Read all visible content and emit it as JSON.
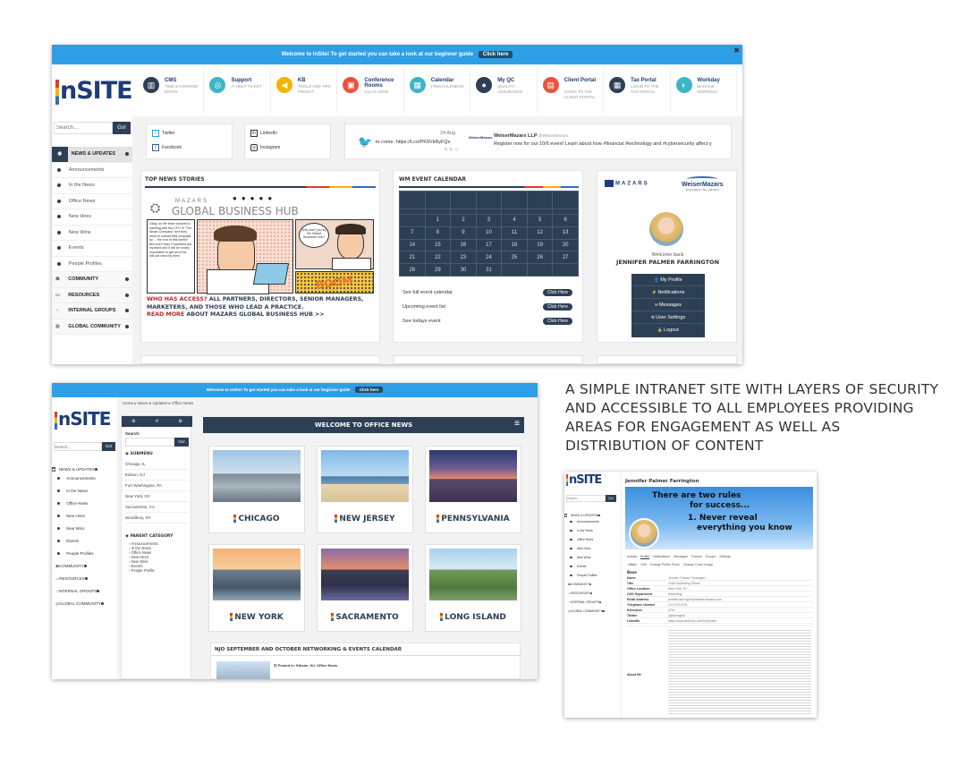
{
  "caption": "A SIMPLE INTRANET SITE WITH LAYERS OF SECURITY AND ACCESSIBLE TO ALL EMPLOYEES PROVIDING AREAS FOR ENGAGEMENT AS WELL AS DISTRIBUTION OF CONTENT",
  "topbar": {
    "text": "Welcome to InSite! To get started you can take a look at our beginner guide",
    "button": "Click here"
  },
  "logo": "nSITE",
  "search": {
    "placeholder": "Search...",
    "button": "Go!"
  },
  "sidebar": [
    {
      "label": "NEWS & UPDATES",
      "type": "main",
      "icon": "rss-icon"
    },
    {
      "label": "Announcements",
      "type": "sub"
    },
    {
      "label": "In the News",
      "type": "sub"
    },
    {
      "label": "Office News",
      "type": "sub"
    },
    {
      "label": "New Hires",
      "type": "sub"
    },
    {
      "label": "New Wins",
      "type": "sub"
    },
    {
      "label": "Events",
      "type": "sub"
    },
    {
      "label": "People Profiles",
      "type": "sub"
    },
    {
      "label": "COMMUNITY",
      "type": "main",
      "icon": "people-icon"
    },
    {
      "label": "RESOURCES",
      "type": "main",
      "icon": "folder-icon"
    },
    {
      "label": "INTERNAL GROUPS",
      "type": "main",
      "icon": "lightbulb-icon"
    },
    {
      "label": "GLOBAL COMMUNITY",
      "type": "main",
      "icon": "globe-icon"
    }
  ],
  "quicklinks": [
    {
      "title": "CMS",
      "sub": "TIME & EXPENSE ENTRY",
      "color": "#2d3f55",
      "icon": "chart-icon"
    },
    {
      "title": "Support",
      "sub": "IT HELP TICKET",
      "color": "#3fb5c8",
      "icon": "lifebuoy-icon"
    },
    {
      "title": "KB",
      "sub": "TOOLS AND TIPS FROM IT",
      "color": "#f5b400",
      "icon": "share-icon"
    },
    {
      "title": "Conference Rooms",
      "sub": "CLICK HERE",
      "color": "#e8543f",
      "icon": "monitor-icon"
    },
    {
      "title": "Calendar",
      "sub": "FIRM CALENDAR",
      "color": "#3fb5c8",
      "icon": "calendar-icon"
    },
    {
      "title": "My QC",
      "sub": "QUALITY ASSURANCE",
      "color": "#2d3f55",
      "icon": "users-icon"
    },
    {
      "title": "Client Portal",
      "sub": "LOGIN TO THE CLIENT PORTAL",
      "color": "#e8543f",
      "icon": "briefcase-icon"
    },
    {
      "title": "Tax Portal",
      "sub": "LOGIN TO THE TAX PORTAL",
      "color": "#2d3f55",
      "icon": "calculator-icon"
    },
    {
      "title": "Workday",
      "sub": "MANAGE WORKDAY",
      "color": "#3fb5c8",
      "icon": "workday-icon"
    }
  ],
  "social": {
    "twitter": "Twitter",
    "facebook": "Facebook",
    "linkedin": "LinkedIn",
    "instagram": "Instagram"
  },
  "tweets": {
    "t1_date": "24 Aug",
    "t1_text": "to come. https://t.co/PK9VkRyFQs",
    "t1_meta": "↰ ↻ ☆",
    "t2_name": "WeiserMazars LLP",
    "t2_handle": "@WeiserMazars",
    "t2_text": "Register now for our 10/6 event! Learn about how #financial #technology and #cybersecurity affect y",
    "t2_logo": "WeiserMazars"
  },
  "news": {
    "heading": "TOP NEWS STORIES",
    "banner_top": "MAZARS",
    "banner": "GLOBAL BUSINESS HUB",
    "speech1": "Okay, as the team secured a meeting with the CFO of \"The Smart Company\" and they need to submit their proposal by ... the end of this week!! But more than 3 countries are involved and it will be nearly impossible to get all of the info we need by then!",
    "speech2": "Why don't you try the Global Business Hub?",
    "boom": "BOOM",
    "who_q": "WHO HAS ACCESS?",
    "who_a": "ALL PARTNERS, DIRECTORS, SENIOR MANAGERS, MARKETERS, AND THOSE WHO LEAD A PRACTICE.",
    "read_more": "READ MORE",
    "read_more_rest": "ABOUT MAZARS GLOBAL BUSINESS HUB >>"
  },
  "calendar": {
    "heading": "WM EVENT CALENDAR",
    "rows": [
      [
        "",
        "1",
        "2",
        "3",
        "4",
        "5",
        "6"
      ],
      [
        "7",
        "8",
        "9",
        "10",
        "11",
        "12",
        "13"
      ],
      [
        "14",
        "15",
        "16",
        "17",
        "18",
        "19",
        "20"
      ],
      [
        "21",
        "22",
        "23",
        "24",
        "25",
        "26",
        "27"
      ],
      [
        "28",
        "29",
        "30",
        "31",
        "",
        "",
        ""
      ]
    ],
    "links": [
      {
        "label": "See full event calendar",
        "btn": "Click Here"
      },
      {
        "label": "Upcoming event list",
        "btn": "Click Here"
      },
      {
        "label": "See todays event",
        "btn": "Click Here"
      }
    ]
  },
  "profile": {
    "brand1": "MAZARS",
    "brand2": "WeiserMazars",
    "brand2_sub": "Accountants | Tax | Advisors",
    "welcome": "Welcome back",
    "name": "JENNIFER PALMER FARRINGTON",
    "menu": [
      "My Profile",
      "Notifications",
      "Messages",
      "User Settings",
      "Logout"
    ]
  },
  "office": {
    "breadcrumb": "Home ▸ News & Updates ▸ Office News",
    "search_label": "Search:",
    "submenu_title": "SUBMENU",
    "submenu": [
      "Chicago, IL",
      "Edison, NJ",
      "Fort Washington, PA",
      "New York, NY",
      "Sacramento, CA",
      "Woodbury, NY"
    ],
    "parent_title": "PARENT CATEGORY",
    "parent": [
      "Announcements",
      "In the News",
      "Office News",
      "New Hires",
      "New Wins",
      "Events",
      "People Profile"
    ],
    "welcome": "WELCOME TO OFFICE NEWS",
    "cities": [
      "CHICAGO",
      "NEW JERSEY",
      "PENNSYLVANIA",
      "NEW YORK",
      "SACRAMENTO",
      "LONG ISLAND"
    ],
    "nj_heading": "NJO SEPTEMBER AND OCTOBER NETWORKING & EVENTS CALENDAR",
    "posted": "Posted in: Edison, NJ, Office News"
  },
  "profile_page": {
    "name": "Jennifer Palmer Farrington",
    "cover1": "There are two rules",
    "cover2": "for success...",
    "cover3": "1.  Never reveal",
    "cover4": "everything you know",
    "tabs": [
      "Activity",
      "Profile",
      "Notifications",
      "Messages",
      "Friends",
      "Groups",
      "Settings"
    ],
    "subtabs": [
      "View",
      "Edit",
      "Change Profile Photo",
      "Change Cover Image"
    ],
    "base": "Base",
    "fields": [
      [
        "Name",
        "Jennifer Palmer Farrington"
      ],
      [
        "Title",
        "Chief Marketing Officer"
      ],
      [
        "Office Location",
        "New York, NY"
      ],
      [
        "OSG Department",
        "Marketing"
      ],
      [
        "Email Address",
        "jennifer.farrington@weisermazars.com"
      ],
      [
        "Telephone Number",
        "212-375-6761"
      ],
      [
        "Extension",
        "6761"
      ],
      [
        "Twitter",
        "@jfarrington"
      ],
      [
        "LinkedIn",
        "https://www.linkedin.com/in/jennifer"
      ]
    ],
    "about_label": "About Me"
  }
}
